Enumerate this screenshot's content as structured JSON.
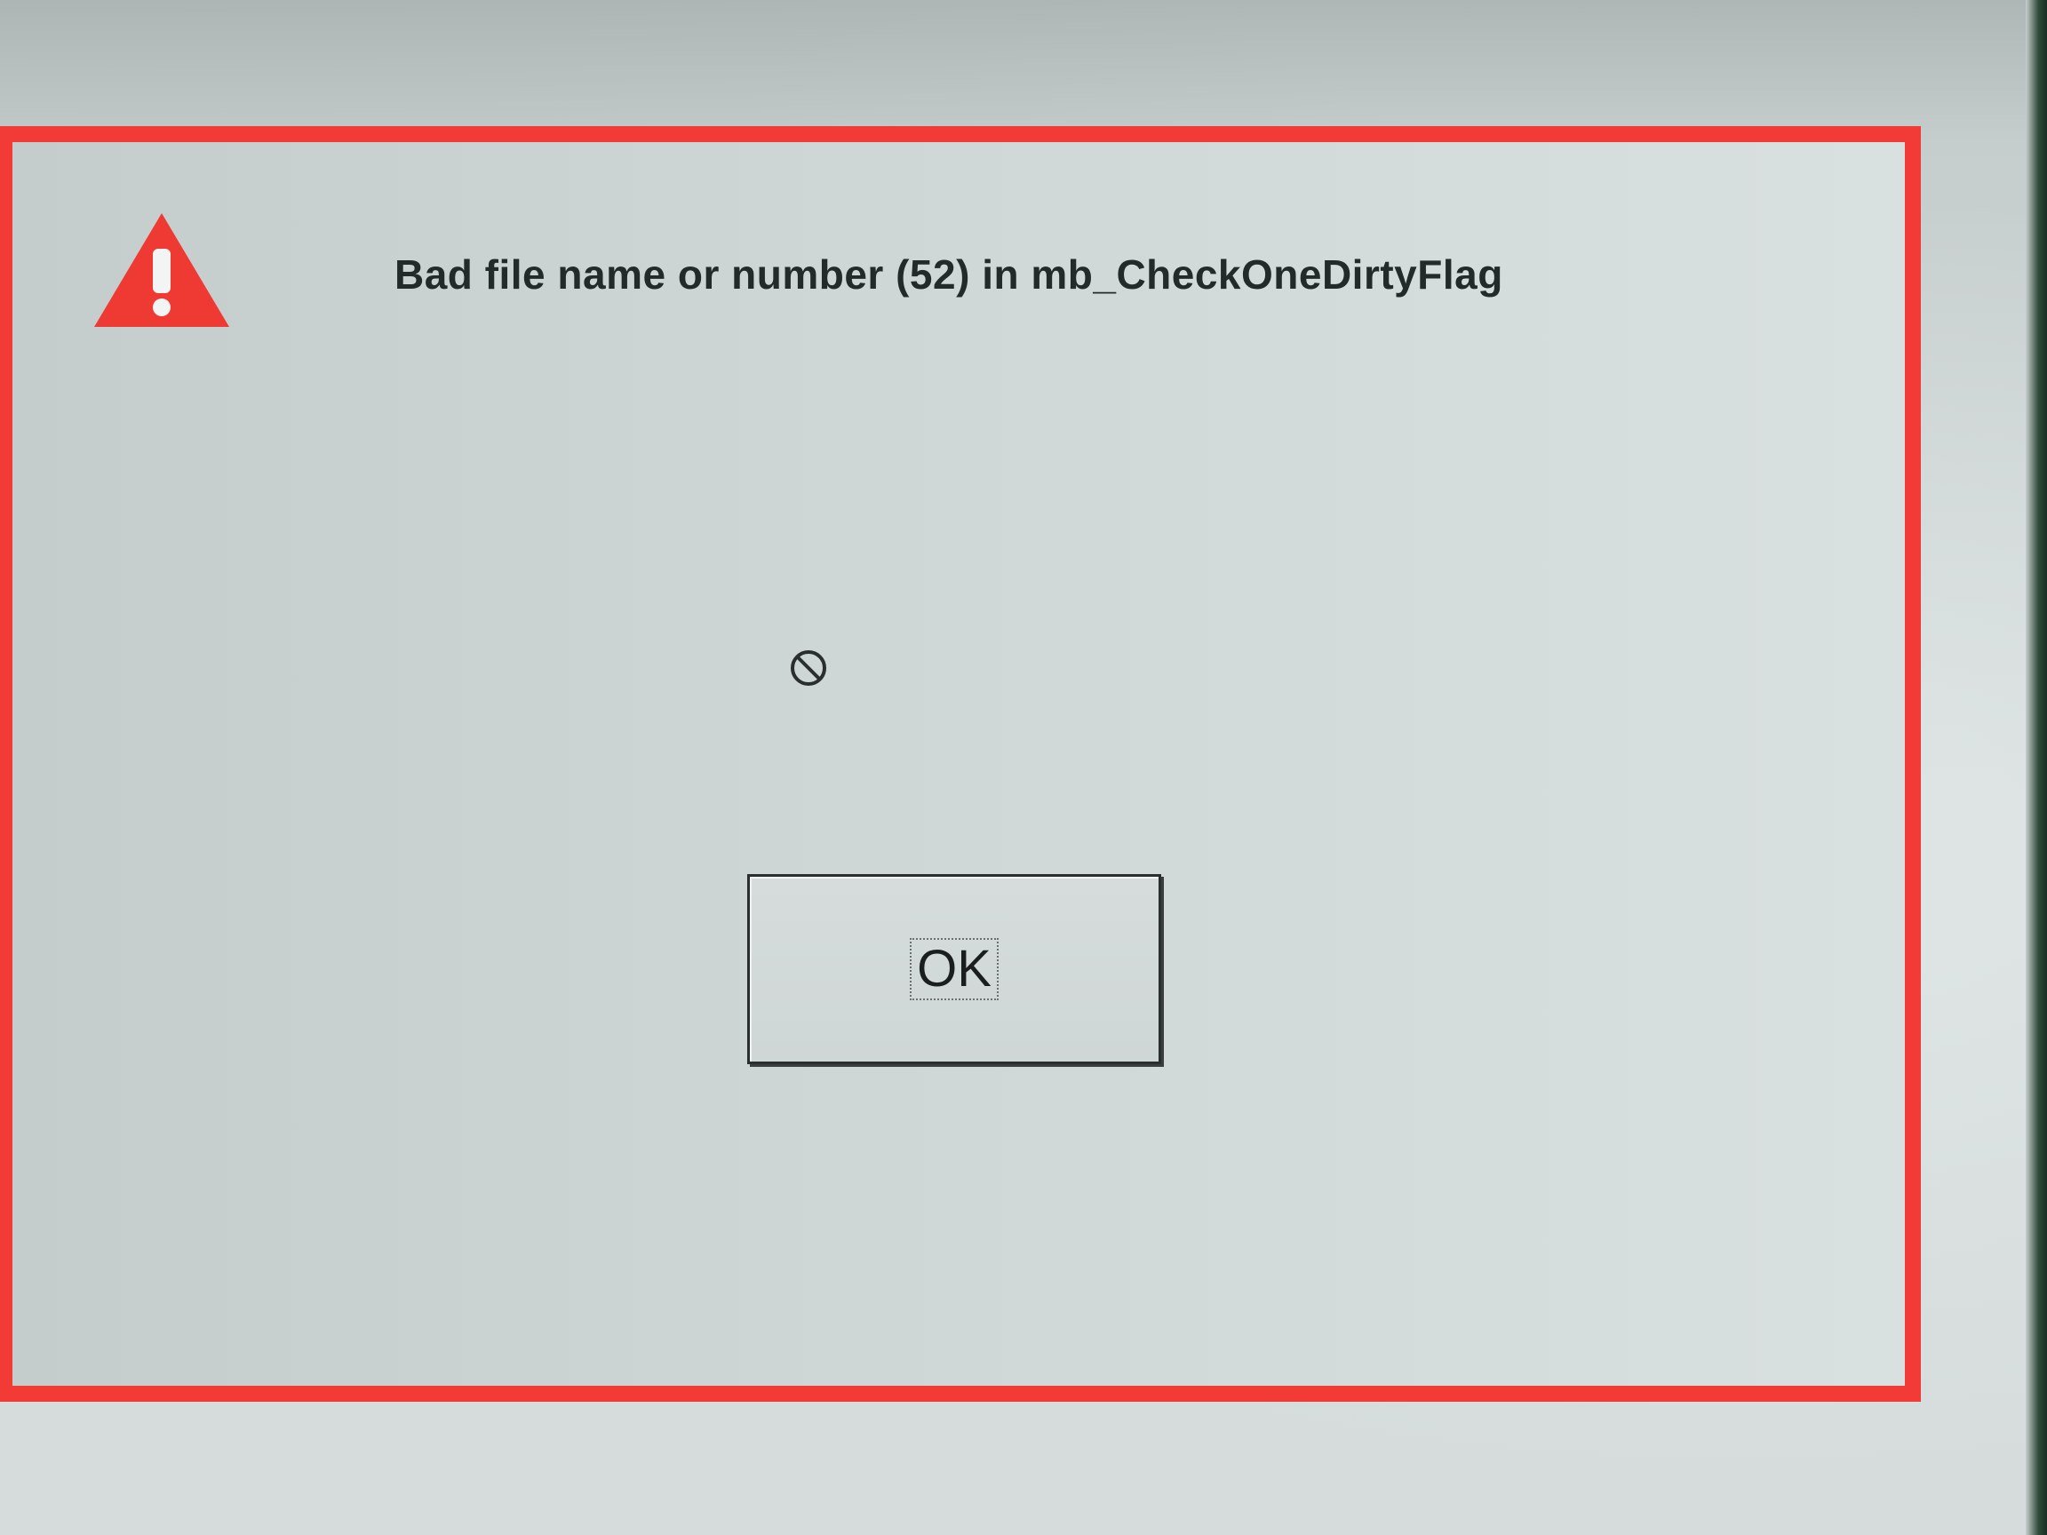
{
  "dialog": {
    "message": "Bad file name or number (52) in mb_CheckOneDirtyFlag",
    "ok_label": "OK",
    "icon": "warning-icon",
    "cursor_icon": "not-allowed-cursor-icon",
    "border_color": "#f23b36"
  }
}
